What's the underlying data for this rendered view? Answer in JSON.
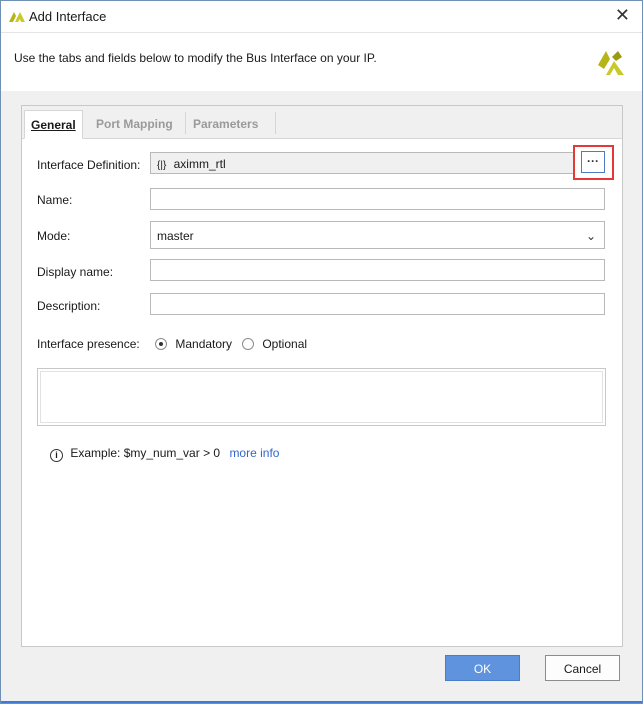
{
  "window": {
    "title": "Add Interface",
    "close_glyph": "✕"
  },
  "header": {
    "description": "Use the tabs and fields below to modify the Bus Interface on your IP."
  },
  "tabs": [
    {
      "label": "General",
      "active": true
    },
    {
      "label": "Port Mapping",
      "active": false
    },
    {
      "label": "Parameters",
      "active": false
    }
  ],
  "form": {
    "interface_definition_label": "Interface Definition:",
    "interface_definition_value": "aximm_rtl",
    "browse_label": "···",
    "name_label": "Name:",
    "name_value": "",
    "mode_label": "Mode:",
    "mode_value": "master",
    "display_name_label": "Display name:",
    "display_name_value": "",
    "description_label": "Description:",
    "description_value": "",
    "presence_label": "Interface presence:",
    "presence_options": [
      {
        "label": "Mandatory",
        "checked": true
      },
      {
        "label": "Optional",
        "checked": false
      }
    ]
  },
  "info": {
    "example_text": "Example:  $my_num_var > 0",
    "more_info_label": "more info"
  },
  "buttons": {
    "ok_label": "OK",
    "cancel_label": "Cancel"
  },
  "colors": {
    "accent": "#5f93de",
    "highlight_box": "#e53935",
    "logo": "#b5b515"
  }
}
